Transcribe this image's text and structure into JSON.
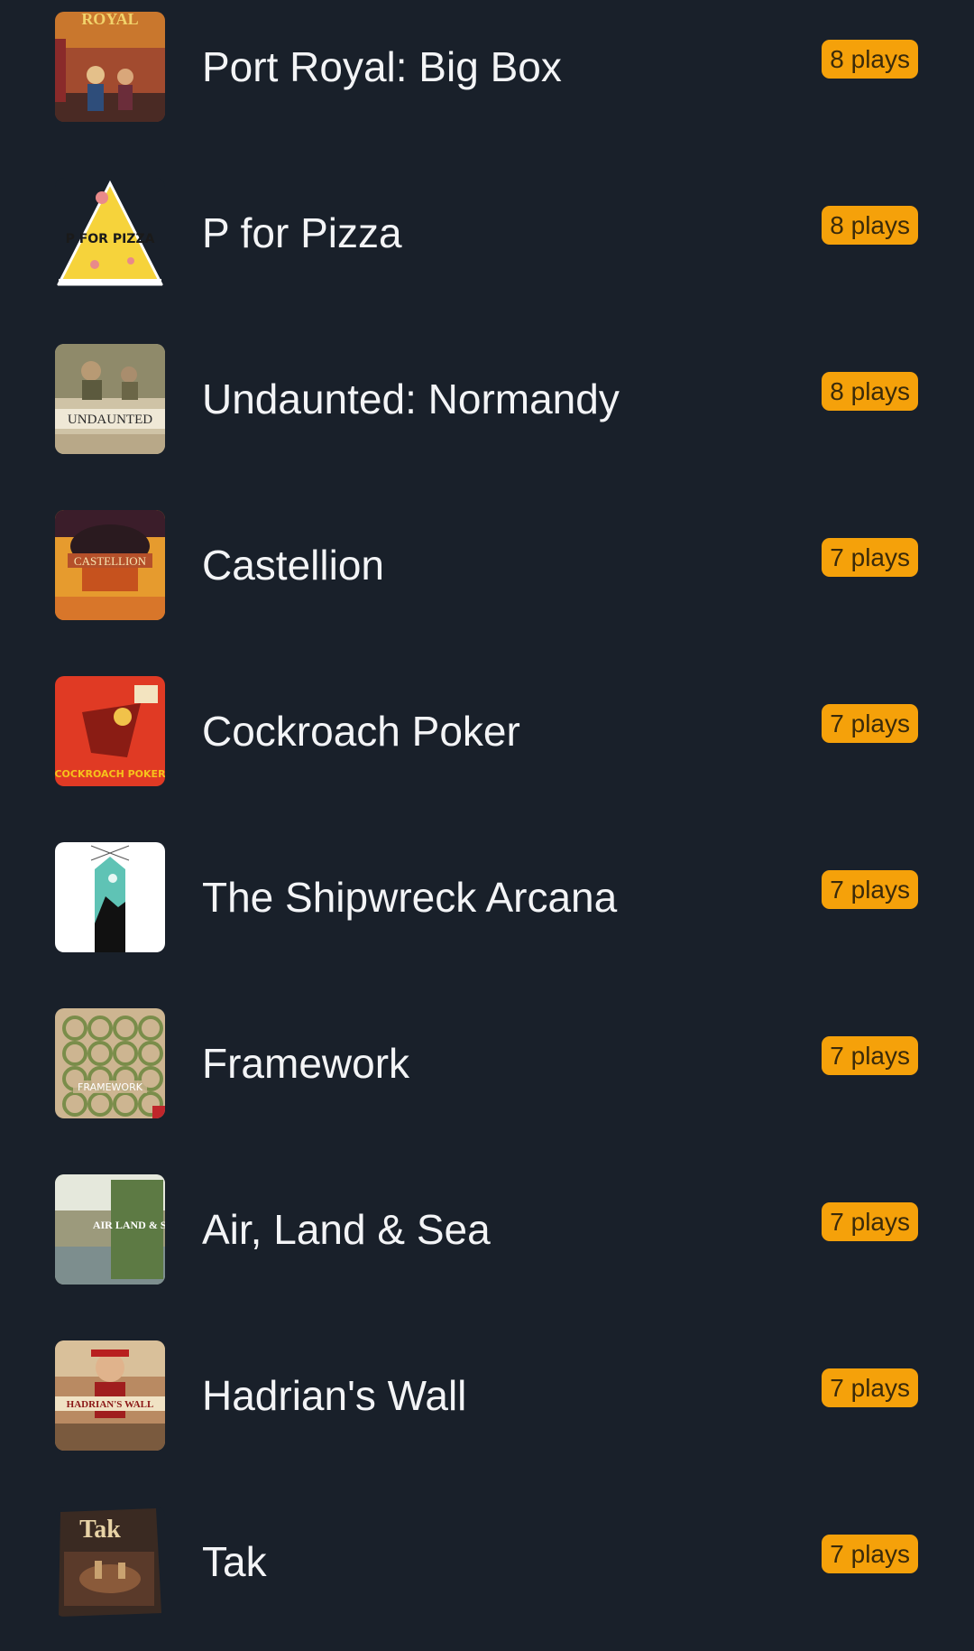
{
  "games": [
    {
      "title": "Port Royal: Big Box",
      "plays": "8 plays",
      "cover_text": "ROYAL"
    },
    {
      "title": "P for Pizza",
      "plays": "8 plays",
      "cover_text": "P FOR PIZZA"
    },
    {
      "title": "Undaunted: Normandy",
      "plays": "8 plays",
      "cover_text": "UNDAUNTED"
    },
    {
      "title": "Castellion",
      "plays": "7 plays",
      "cover_text": "CASTELLION"
    },
    {
      "title": "Cockroach Poker",
      "plays": "7 plays",
      "cover_text": "COCKROACH POKER"
    },
    {
      "title": "The Shipwreck Arcana",
      "plays": "7 plays",
      "cover_text": ""
    },
    {
      "title": "Framework",
      "plays": "7 plays",
      "cover_text": "FRAMEWORK"
    },
    {
      "title": "Air, Land & Sea",
      "plays": "7 plays",
      "cover_text": "AIR LAND & SEA"
    },
    {
      "title": "Hadrian's Wall",
      "plays": "7 plays",
      "cover_text": "HADRIAN'S WALL"
    },
    {
      "title": "Tak",
      "plays": "7 plays",
      "cover_text": "Tak"
    }
  ],
  "colors": {
    "background": "#19202a",
    "badge": "#f5a10a",
    "badge_text": "#3a2a0a",
    "title_text": "#f3f4f6"
  }
}
